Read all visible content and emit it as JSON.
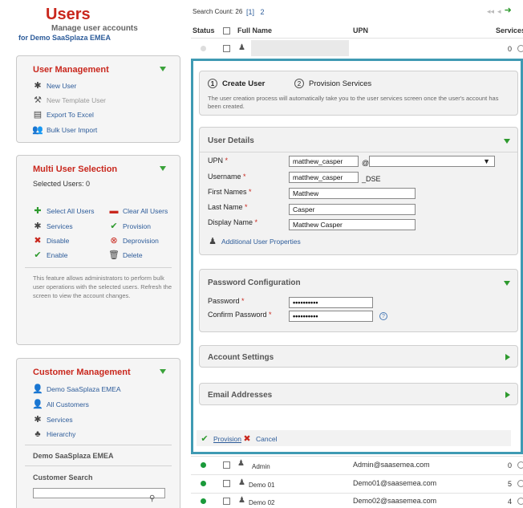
{
  "header": {
    "title": "Users",
    "subtitle": "Manage user accounts",
    "org_line": "for Demo SaaSplaza EMEA"
  },
  "user_management": {
    "title": "User Management",
    "items": [
      {
        "label": "New User",
        "icon": "new-user-icon",
        "enabled": true
      },
      {
        "label": "New Template User",
        "icon": "wrench-icon",
        "enabled": false
      },
      {
        "label": "Export To Excel",
        "icon": "excel-icon",
        "enabled": true
      },
      {
        "label": "Bulk User Import",
        "icon": "users-icon",
        "enabled": true
      }
    ]
  },
  "multi_select": {
    "title": "Multi User Selection",
    "selected_label": "Selected Users: 0",
    "items": [
      {
        "label": "Select All Users",
        "icon": "plus-icon"
      },
      {
        "label": "Clear All Users",
        "icon": "minus-icon"
      },
      {
        "label": "Services",
        "icon": "services-icon"
      },
      {
        "label": "Provision",
        "icon": "check-circle-icon"
      },
      {
        "label": "Disable",
        "icon": "x-icon"
      },
      {
        "label": "Deprovision",
        "icon": "x-circle-icon"
      },
      {
        "label": "Enable",
        "icon": "check-icon"
      },
      {
        "label": "Delete",
        "icon": "trash-icon"
      }
    ],
    "note": "This feature allows administrators to perform bulk user operations with the selected users. Refresh the screen to view the account changes."
  },
  "customer_management": {
    "title": "Customer Management",
    "items": [
      {
        "label": "Demo SaaSplaza EMEA",
        "icon": "customer-icon"
      },
      {
        "label": "All Customers",
        "icon": "person-icon"
      },
      {
        "label": "Services",
        "icon": "services-icon"
      },
      {
        "label": "Hierarchy",
        "icon": "hierarchy-icon"
      }
    ],
    "current": "Demo SaaSplaza EMEA",
    "search_label": "Customer Search"
  },
  "list": {
    "search_count": "Search Count: 26",
    "pages": [
      "[1]",
      "2"
    ],
    "columns": {
      "status": "Status",
      "full_name": "Full Name",
      "upn": "UPN",
      "services": "Services"
    },
    "top_row": {
      "services": "0"
    },
    "rows": [
      {
        "name": "Admin",
        "upn": "Admin@saasemea.com",
        "services": "0"
      },
      {
        "name": "Demo 01",
        "upn": "Demo01@saasemea.com",
        "services": "5"
      },
      {
        "name": "Demo 02",
        "upn": "Demo02@saasemea.com",
        "services": "4"
      }
    ]
  },
  "modal": {
    "steps": [
      {
        "num": "1",
        "label": "Create User"
      },
      {
        "num": "2",
        "label": "Provision Services"
      }
    ],
    "intro": "The user creation process will automatically take you to the user services screen once the user's account has been created.",
    "user_details": {
      "title": "User Details",
      "upn_label": "UPN",
      "upn_value": "matthew_casper",
      "at": "@",
      "username_label": "Username",
      "username_value": "matthew_casper",
      "username_suffix": "_DSE",
      "first_label": "First Names",
      "first_value": "Matthew",
      "last_label": "Last Name",
      "last_value": "Casper",
      "display_label": "Display Name",
      "display_value": "Matthew Casper",
      "additional": "Additional User Properties"
    },
    "password": {
      "title": "Password Configuration",
      "password_label": "Password",
      "password_value": "••••••••••",
      "confirm_label": "Confirm Password",
      "confirm_value": "••••••••••"
    },
    "account_settings": "Account Settings",
    "email_addresses": "Email Addresses",
    "provision": "Provision",
    "cancel": "Cancel",
    "required_mark": "*"
  },
  "colors": {
    "accent_red": "#c9271d",
    "link_blue": "#2d5c9a",
    "green": "#2e9a2e",
    "modal_border": "#3f9ab3"
  }
}
